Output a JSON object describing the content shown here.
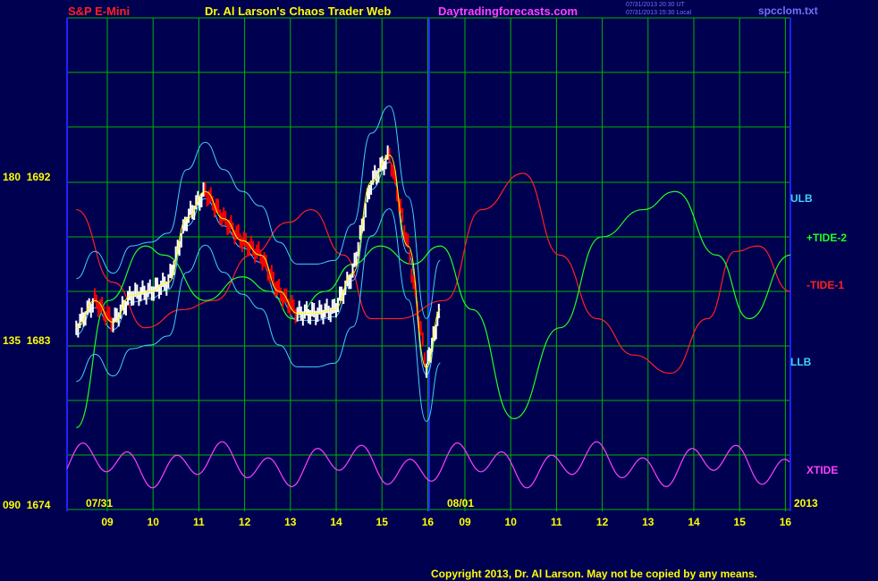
{
  "header": {
    "instrument": "S&P E-Mini",
    "title": "Dr. Al Larson's Chaos Trader Web",
    "site": "Daytradingforecasts.com",
    "timestamp1": "07/31/2013 20:30 UT",
    "timestamp2": "07/31/2013 15:30 Local",
    "file": "spcclom.txt"
  },
  "copyright": "Copyright 2013, Dr. Al Larson. May not be copied by any means.",
  "colors": {
    "background": "#000050",
    "grid": "#00b400",
    "axis": "#2020ff",
    "price_up": "#ffffff",
    "price_down": "#ff0000",
    "tide1": "#ff2020",
    "tide2": "#20ff20",
    "bands": "#40d0ff",
    "xtide": "#ff40ff",
    "fast_ma": "#ffff00"
  },
  "chart_data": {
    "type": "line",
    "title": "S&P E-Mini",
    "y_axis_labels": [
      {
        "angle": "180",
        "price": "1692"
      },
      {
        "angle": "135",
        "price": "1683"
      },
      {
        "angle": "090",
        "price": "1674"
      }
    ],
    "date_labels": [
      "07/31",
      "08/01",
      "2013"
    ],
    "hour_ticks": [
      "09",
      "10",
      "11",
      "12",
      "13",
      "14",
      "15",
      "16",
      "09",
      "10",
      "11",
      "12",
      "13",
      "14",
      "15",
      "16"
    ],
    "series_labels": [
      "ULB",
      "+TIDE-2",
      "-TIDE-1",
      "LLB",
      "XTIDE"
    ],
    "hours": [
      8.2,
      8.6,
      9.0,
      9.4,
      9.8,
      10.2,
      10.6,
      11.0,
      11.4,
      11.8,
      12.2,
      12.6,
      13.0,
      13.4,
      13.8,
      14.2,
      14.6,
      15.0,
      15.4,
      15.8,
      16.1
    ],
    "price": [
      1684.0,
      1685.5,
      1684.3,
      1685.8,
      1686.0,
      1686.5,
      1690.0,
      1691.5,
      1690.0,
      1688.8,
      1688.0,
      1686.0,
      1684.8,
      1684.8,
      1685.0,
      1687.0,
      1692.0,
      1693.5,
      1688.5,
      1681.8,
      1685.0
    ],
    "tide1_hours": [
      8.2,
      9.0,
      9.7,
      10.5,
      11.2,
      12.0,
      12.8,
      13.3,
      14.0,
      14.6,
      15.2,
      16.2,
      17.0,
      17.9,
      18.7,
      19.5,
      20.3,
      21.1,
      21.9,
      22.5,
      23.0,
      23.7
    ],
    "tide1": [
      1690.5,
      1686.5,
      1684.0,
      1685.0,
      1685.5,
      1688.0,
      1689.8,
      1690.5,
      1688.0,
      1684.5,
      1684.5,
      1685.5,
      1690.5,
      1692.5,
      1688.0,
      1684.5,
      1682.5,
      1681.5,
      1684.5,
      1688.2,
      1688.5,
      1686.0
    ],
    "tide2_hours": [
      8.2,
      8.9,
      9.7,
      10.1,
      11.0,
      11.8,
      12.4,
      12.9,
      13.6,
      14.2,
      14.8,
      15.5,
      16.1,
      16.8,
      17.7,
      18.7,
      19.6,
      20.5,
      21.2,
      22.1,
      22.8,
      23.7
    ],
    "tide2": [
      1678.5,
      1685.5,
      1688.5,
      1688.0,
      1685.5,
      1686.8,
      1686.0,
      1684.5,
      1686.0,
      1687.5,
      1688.5,
      1687.5,
      1688.5,
      1685.0,
      1679.0,
      1684.0,
      1689.0,
      1690.5,
      1691.5,
      1688.0,
      1684.5,
      1688.0
    ]
  }
}
